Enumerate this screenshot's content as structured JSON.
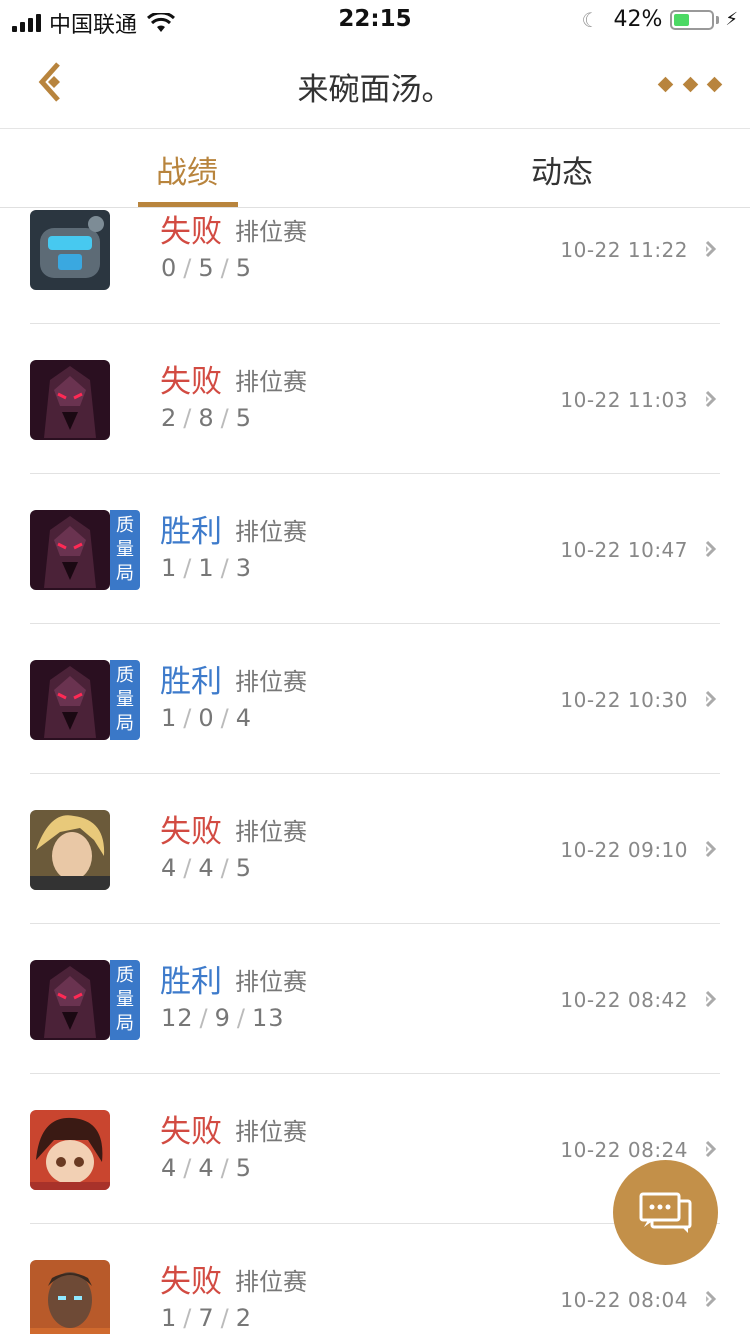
{
  "status": {
    "carrier": "中国联通",
    "time": "22:15",
    "battery_pct": "42%",
    "battery_level": 0.42
  },
  "nav": {
    "title": "来碗面汤。",
    "back_icon": "back-chevron-icon",
    "more_icon": "more-diamonds-icon"
  },
  "tabs": [
    {
      "label": "战绩",
      "active": true
    },
    {
      "label": "动态",
      "active": false
    }
  ],
  "colors": {
    "accent": "#b8843d",
    "loss": "#d24b42",
    "win": "#3e7bcb",
    "badge": "#3a78c8"
  },
  "matches": [
    {
      "hero": "hero-ice-giant-avatar",
      "result": "失败",
      "outcome": "loss",
      "mode": "排位赛",
      "k": "0",
      "d": "5",
      "a": "5",
      "time": "10-22 11:22",
      "quality": ""
    },
    {
      "hero": "hero-dark-knight-avatar",
      "result": "失败",
      "outcome": "loss",
      "mode": "排位赛",
      "k": "2",
      "d": "8",
      "a": "5",
      "time": "10-22 11:03",
      "quality": ""
    },
    {
      "hero": "hero-dark-knight-avatar",
      "result": "胜利",
      "outcome": "win",
      "mode": "排位赛",
      "k": "1",
      "d": "1",
      "a": "3",
      "time": "10-22 10:47",
      "quality": "质量局"
    },
    {
      "hero": "hero-dark-knight-avatar",
      "result": "胜利",
      "outcome": "win",
      "mode": "排位赛",
      "k": "1",
      "d": "0",
      "a": "4",
      "time": "10-22 10:30",
      "quality": "质量局"
    },
    {
      "hero": "hero-blonde-swordsman-avatar",
      "result": "失败",
      "outcome": "loss",
      "mode": "排位赛",
      "k": "4",
      "d": "4",
      "a": "5",
      "time": "10-22 09:10",
      "quality": ""
    },
    {
      "hero": "hero-dark-knight-avatar",
      "result": "胜利",
      "outcome": "win",
      "mode": "排位赛",
      "k": "12",
      "d": "9",
      "a": "13",
      "time": "10-22 08:42",
      "quality": "质量局"
    },
    {
      "hero": "hero-chibi-girl-avatar",
      "result": "失败",
      "outcome": "loss",
      "mode": "排位赛",
      "k": "4",
      "d": "4",
      "a": "5",
      "time": "10-22 08:24",
      "quality": ""
    },
    {
      "hero": "hero-warrior-avatar",
      "result": "失败",
      "outcome": "loss",
      "mode": "排位赛",
      "k": "1",
      "d": "7",
      "a": "2",
      "time": "10-22 08:04",
      "quality": ""
    }
  ],
  "chat_icon": "chat-bubbles-icon"
}
